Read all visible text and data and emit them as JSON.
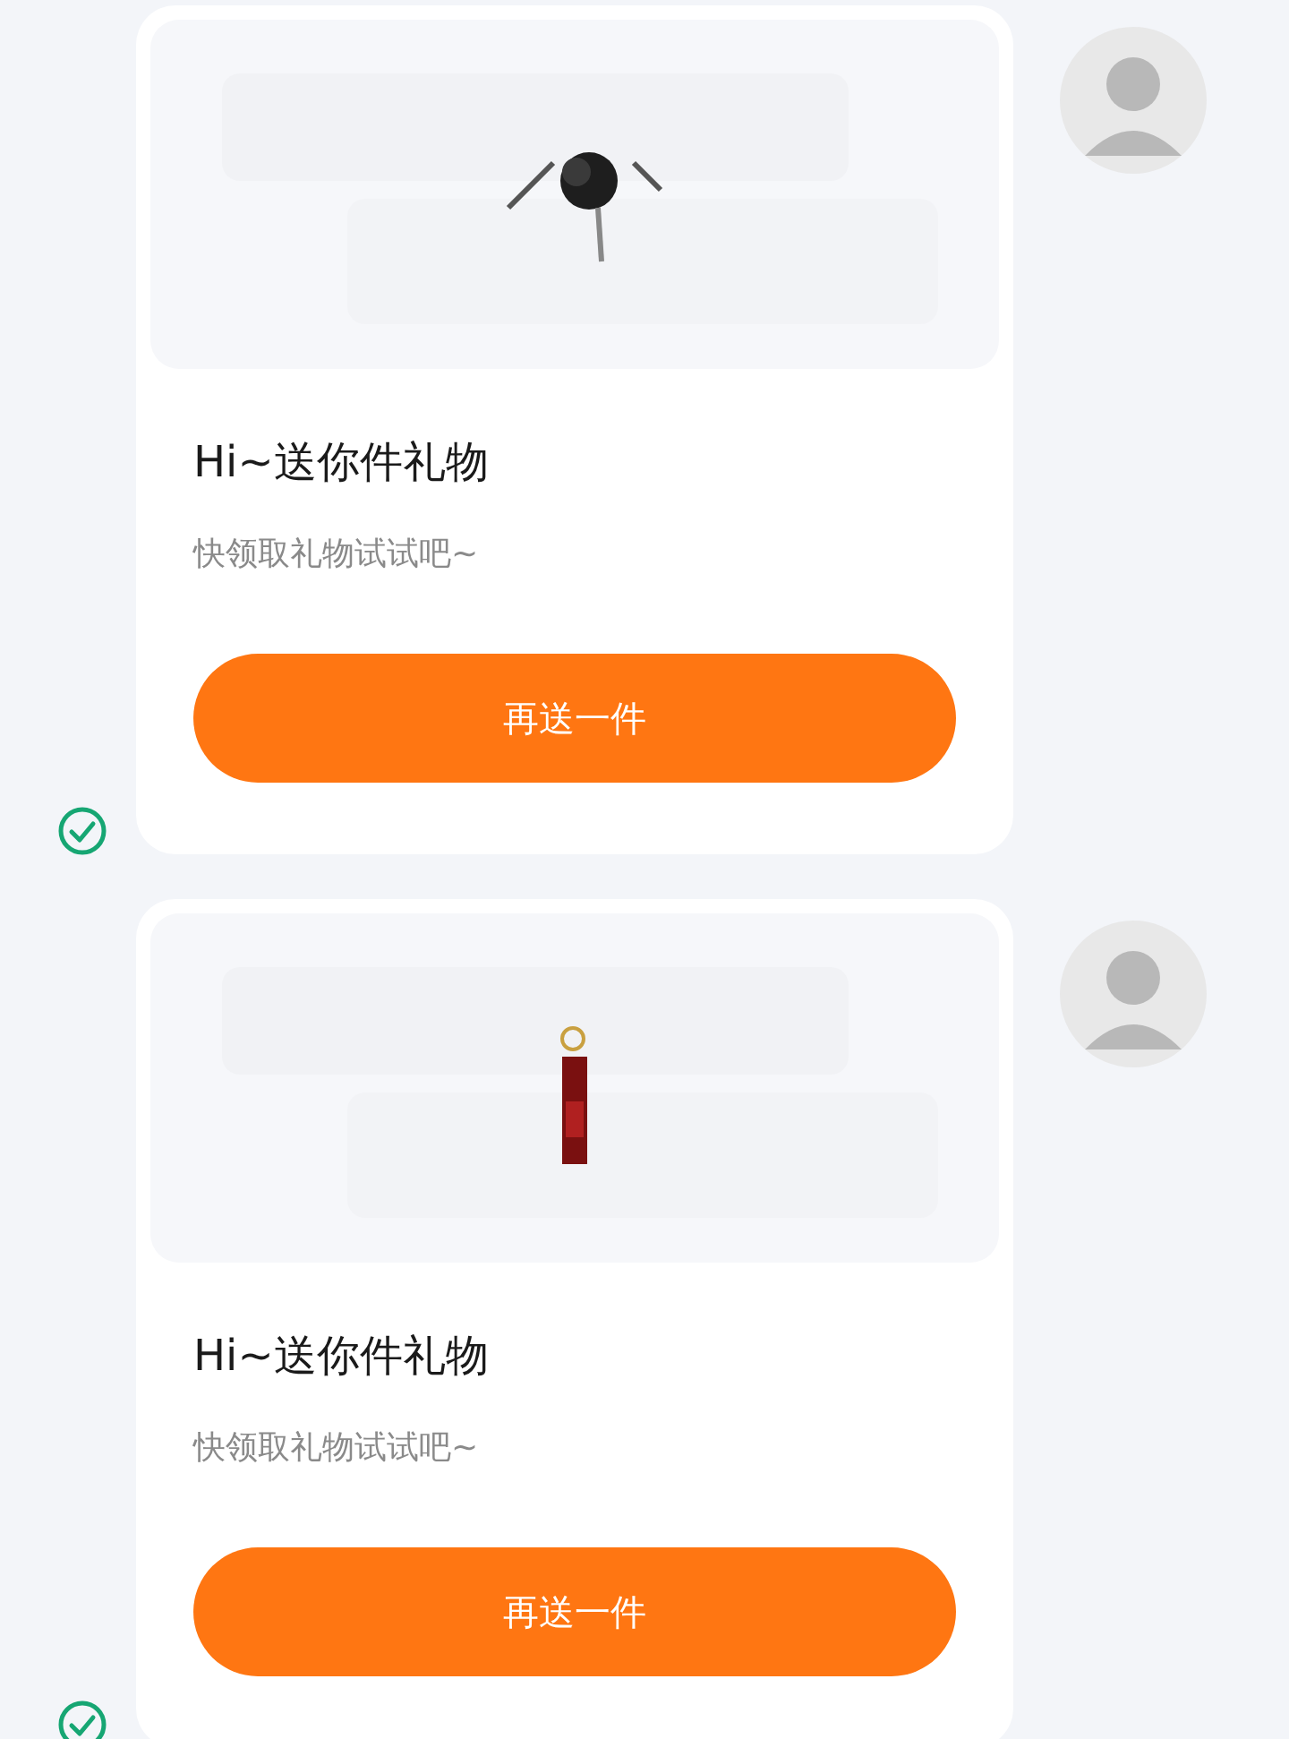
{
  "messages": [
    {
      "title": "Hi~送你件礼物",
      "subtitle": "快领取礼物试试吧~",
      "button": "再送一件",
      "delivered": true
    },
    {
      "title": "Hi~送你件礼物",
      "subtitle": "快领取礼物试试吧~",
      "button": "再送一件",
      "delivered": true
    }
  ]
}
